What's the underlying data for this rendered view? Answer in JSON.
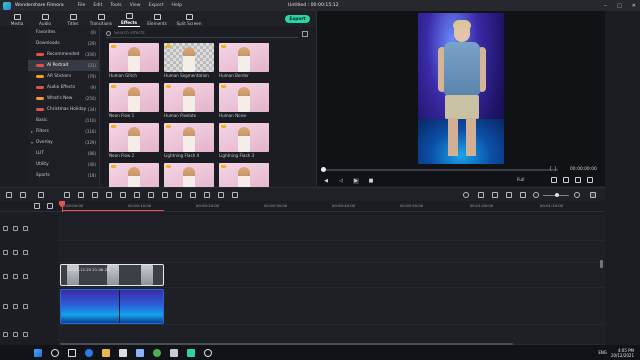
{
  "titlebar": {
    "app_name": "Wondershare Filmora",
    "menu": [
      "File",
      "Edit",
      "Tools",
      "View",
      "Export",
      "Help"
    ],
    "document": "Untitled : 00:00:15:12",
    "controls": [
      "‒",
      "□",
      "✕"
    ]
  },
  "toolbar": {
    "items": [
      "Media",
      "Audio",
      "Titles",
      "Transitions",
      "Effects",
      "Elements",
      "Split Screen"
    ],
    "active": "Effects",
    "export_label": "Export"
  },
  "categories": [
    {
      "label": "Favorites",
      "count": "(0)",
      "arrow": "",
      "badge": ""
    },
    {
      "label": "Downloads",
      "count": "(29)",
      "arrow": "",
      "badge": ""
    },
    {
      "label": "Recommended",
      "count": "(300)",
      "arrow": "",
      "badge": "red"
    },
    {
      "label": "AI Portrait",
      "count": "(31)",
      "arrow": "",
      "badge": "red",
      "selected": true
    },
    {
      "label": "AR Stickers",
      "count": "(79)",
      "arrow": "",
      "badge": "orange"
    },
    {
      "label": "Audio Effects",
      "count": "(9)",
      "arrow": "",
      "badge": "red"
    },
    {
      "label": "What's New",
      "count": "(250)",
      "arrow": "",
      "badge": "orange"
    },
    {
      "label": "Christmas Holiday",
      "count": "(34)",
      "arrow": "",
      "badge": "red"
    },
    {
      "label": "Basic",
      "count": "(116)",
      "arrow": "",
      "badge": ""
    },
    {
      "label": "Filters",
      "count": "(316)",
      "arrow": "▸",
      "badge": ""
    },
    {
      "label": "Overlay",
      "count": "(329)",
      "arrow": "▾",
      "badge": ""
    },
    {
      "label": "LUT",
      "count": "(86)",
      "arrow": "",
      "badge": ""
    },
    {
      "label": "Utility",
      "count": "(40)",
      "arrow": "",
      "badge": ""
    },
    {
      "label": "Sports",
      "count": "(18)",
      "arrow": "",
      "badge": ""
    }
  ],
  "search": {
    "placeholder": "Search effects"
  },
  "effects": [
    {
      "name": "Human Glitch",
      "style": "plain"
    },
    {
      "name": "Human Segmentation",
      "style": "checker"
    },
    {
      "name": "Human Border",
      "style": "plain"
    },
    {
      "name": "Neon Flow 1",
      "style": "plain"
    },
    {
      "name": "Human Pixelate",
      "style": "plain"
    },
    {
      "name": "Human Noise",
      "style": "plain"
    },
    {
      "name": "Neon Flow 2",
      "style": "plain"
    },
    {
      "name": "Lightning Flash 4",
      "style": "plain"
    },
    {
      "name": "Lightning Flash 3",
      "style": "plain"
    },
    {
      "name": "",
      "style": "plain"
    },
    {
      "name": "",
      "style": "plain"
    },
    {
      "name": "",
      "style": "plain"
    }
  ],
  "preview": {
    "timecode": "00:00:00:00",
    "brackets": "{   }",
    "quality": "Full",
    "progress": 0
  },
  "ruler": {
    "labels": [
      "00:00:00:00",
      "00:00:10:00",
      "00:00:20:00",
      "00:00:30:00",
      "00:00:40:00",
      "00:00:50:00",
      "00:01:00:00",
      "00:01:10:00",
      "00:01:20:00"
    ]
  },
  "timeline": {
    "clip1_label": "2021-12-20 21-06-28"
  },
  "taskbar": {
    "lang": "ENG",
    "time": "4:05 PM",
    "date": "20/12/2021"
  },
  "colors": {
    "accent": "#2bd3a5",
    "playhead": "#e9514b",
    "selected_bg": "#363a43"
  }
}
